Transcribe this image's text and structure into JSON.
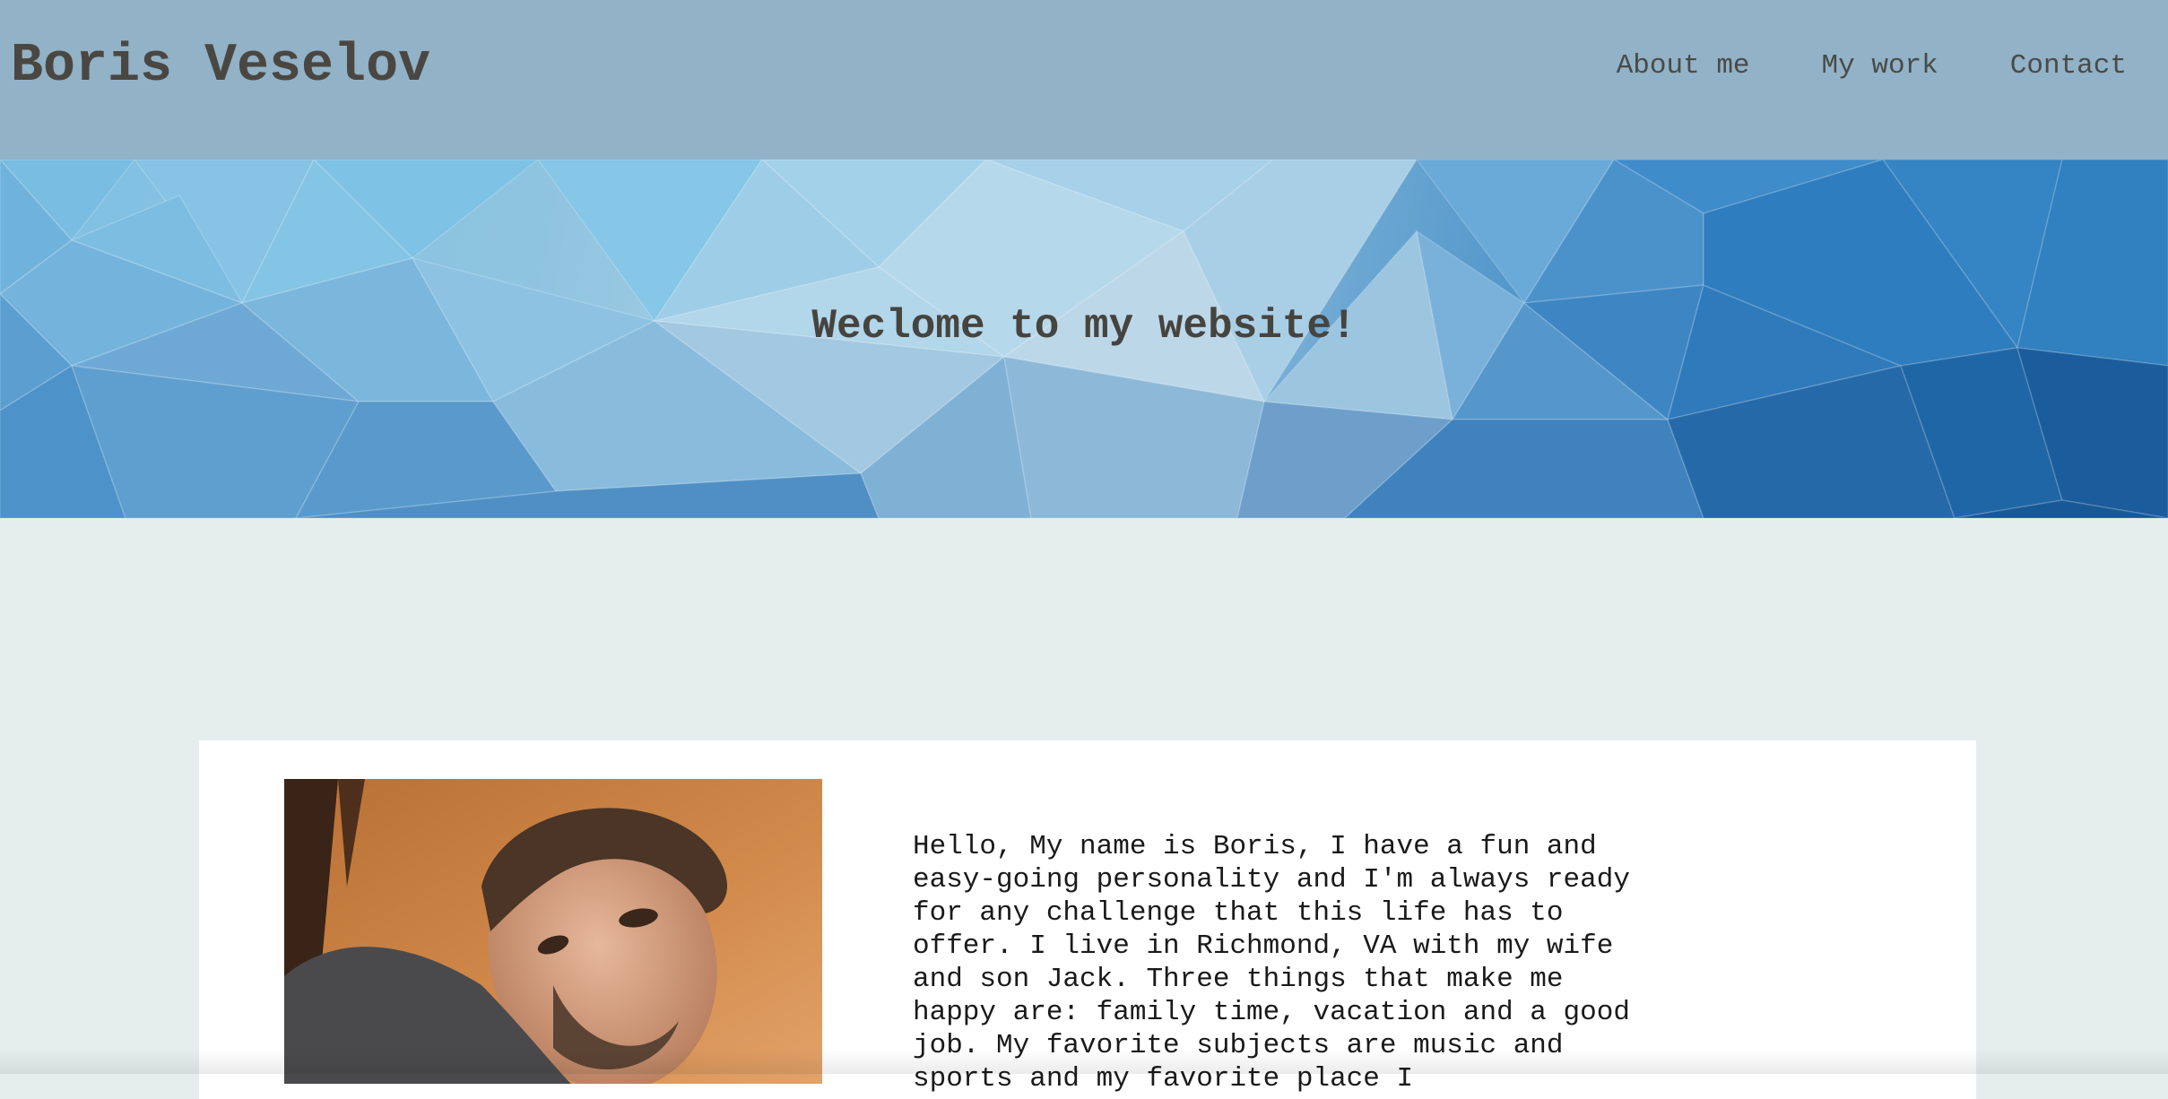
{
  "header": {
    "site_title": "Boris Veselov",
    "nav": [
      {
        "label": "About me"
      },
      {
        "label": "My work"
      },
      {
        "label": "Contact"
      }
    ]
  },
  "hero": {
    "title": "Weclome to my website!"
  },
  "about": {
    "text": "Hello, My name is Boris, I have a fun and easy-going personality and I'm always ready for any challenge that this life has to offer. I live in Richmond, VA with my wife and son Jack. Three things that make me happy are: family time, vacation and a good job. My favorite subjects are music and sports and my favorite place I"
  },
  "colors": {
    "header_bg": "#91b2c7",
    "page_bg": "#e6eeed",
    "title_color": "#4a4742"
  }
}
